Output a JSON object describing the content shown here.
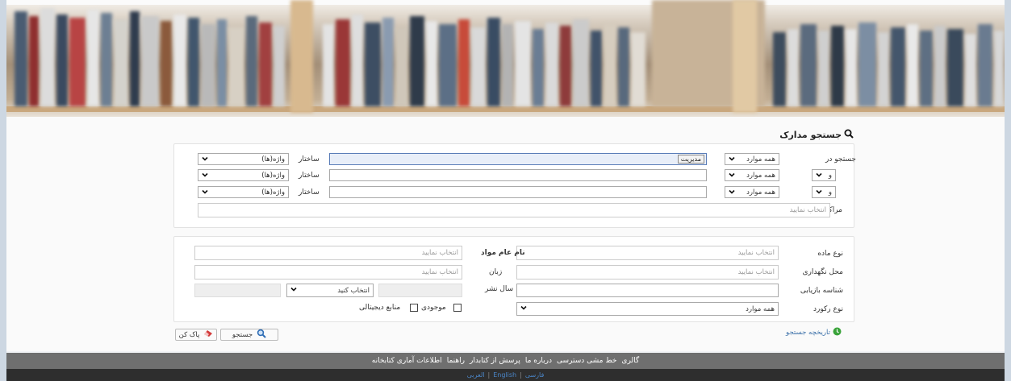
{
  "search": {
    "title": "جستجو مدارک",
    "search_in_label": "جستجو در",
    "structure_label": "ساختار",
    "rows": [
      {
        "operator": "",
        "field": "همه موارد",
        "value": "مدیریت",
        "structure": "واژه(ها)"
      },
      {
        "operator": "و",
        "field": "همه موارد",
        "value": "",
        "structure": "واژه(ها)"
      },
      {
        "operator": "و",
        "field": "همه موارد",
        "value": "",
        "structure": "واژه(ها)"
      }
    ],
    "centers_label": "مراکز",
    "centers_placeholder": "انتخاب نمایید"
  },
  "filters": {
    "material_type_label": "نوع ماده",
    "material_type_placeholder": "انتخاب نمایید",
    "general_material_label": "نام عام مواد",
    "general_material_placeholder": "انتخاب نمایید",
    "location_label": "محل نگهداری",
    "location_placeholder": "انتخاب نمایید",
    "language_label": "زبان",
    "language_placeholder": "انتخاب نمایید",
    "call_number_label": "شناسه بازیابی",
    "pub_year_label": "سال نشر",
    "pub_year_select": "انتخاب کنید",
    "record_type_label": "نوع رکورد",
    "record_type_value": "همه موارد",
    "availability_label": "موجودی",
    "digital_label": "منابع دیجیتالی"
  },
  "actions": {
    "search_button": "جستجو",
    "clear_button": "پاک کن",
    "history_link": "تاریخچه جستجو"
  },
  "footer": {
    "links": [
      "گالری",
      "خط مشی دسترسی",
      "درباره ما",
      "پرسش از کتابدار",
      "راهنما",
      "اطلاعات آماری کتابخانه"
    ],
    "languages": [
      "فارسی",
      "English",
      "العربی"
    ]
  },
  "colors": {
    "footer_top": "#6f6f6f",
    "footer_bottom": "#2e2e2e",
    "link": "#3a6fa8",
    "highlight_border": "#5a7db8"
  }
}
